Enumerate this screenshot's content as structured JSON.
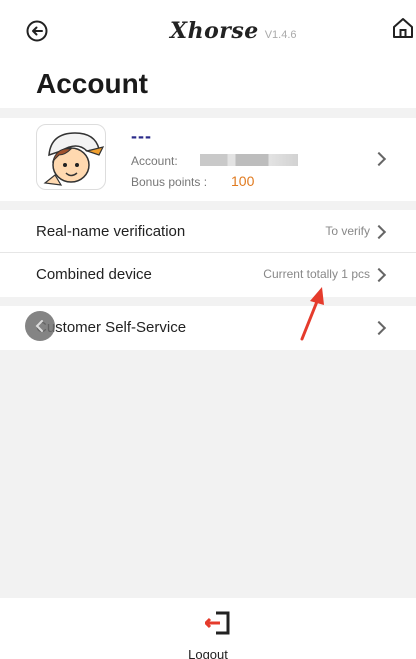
{
  "header": {
    "logo_text": "Xhorse",
    "version": "V1.4.6",
    "back_icon": "back-circle-icon",
    "home_icon": "home-icon"
  },
  "page_title": "Account",
  "profile": {
    "nickname": "---",
    "account_label": "Account:",
    "bonus_label": "Bonus points :",
    "bonus_value": "100"
  },
  "menu": {
    "realname": {
      "label": "Real-name verification",
      "value": "To verify"
    },
    "combined": {
      "label": "Combined device",
      "value": "Current totally 1 pcs"
    },
    "self_service": {
      "label": "Customer Self-Service"
    }
  },
  "logout": {
    "label": "Logout"
  },
  "colors": {
    "bonus": "#e07a1f",
    "nickname": "#2b2b8a",
    "arrow_annotation": "#e53b2c",
    "logout_icon_accent": "#e53b2c"
  }
}
